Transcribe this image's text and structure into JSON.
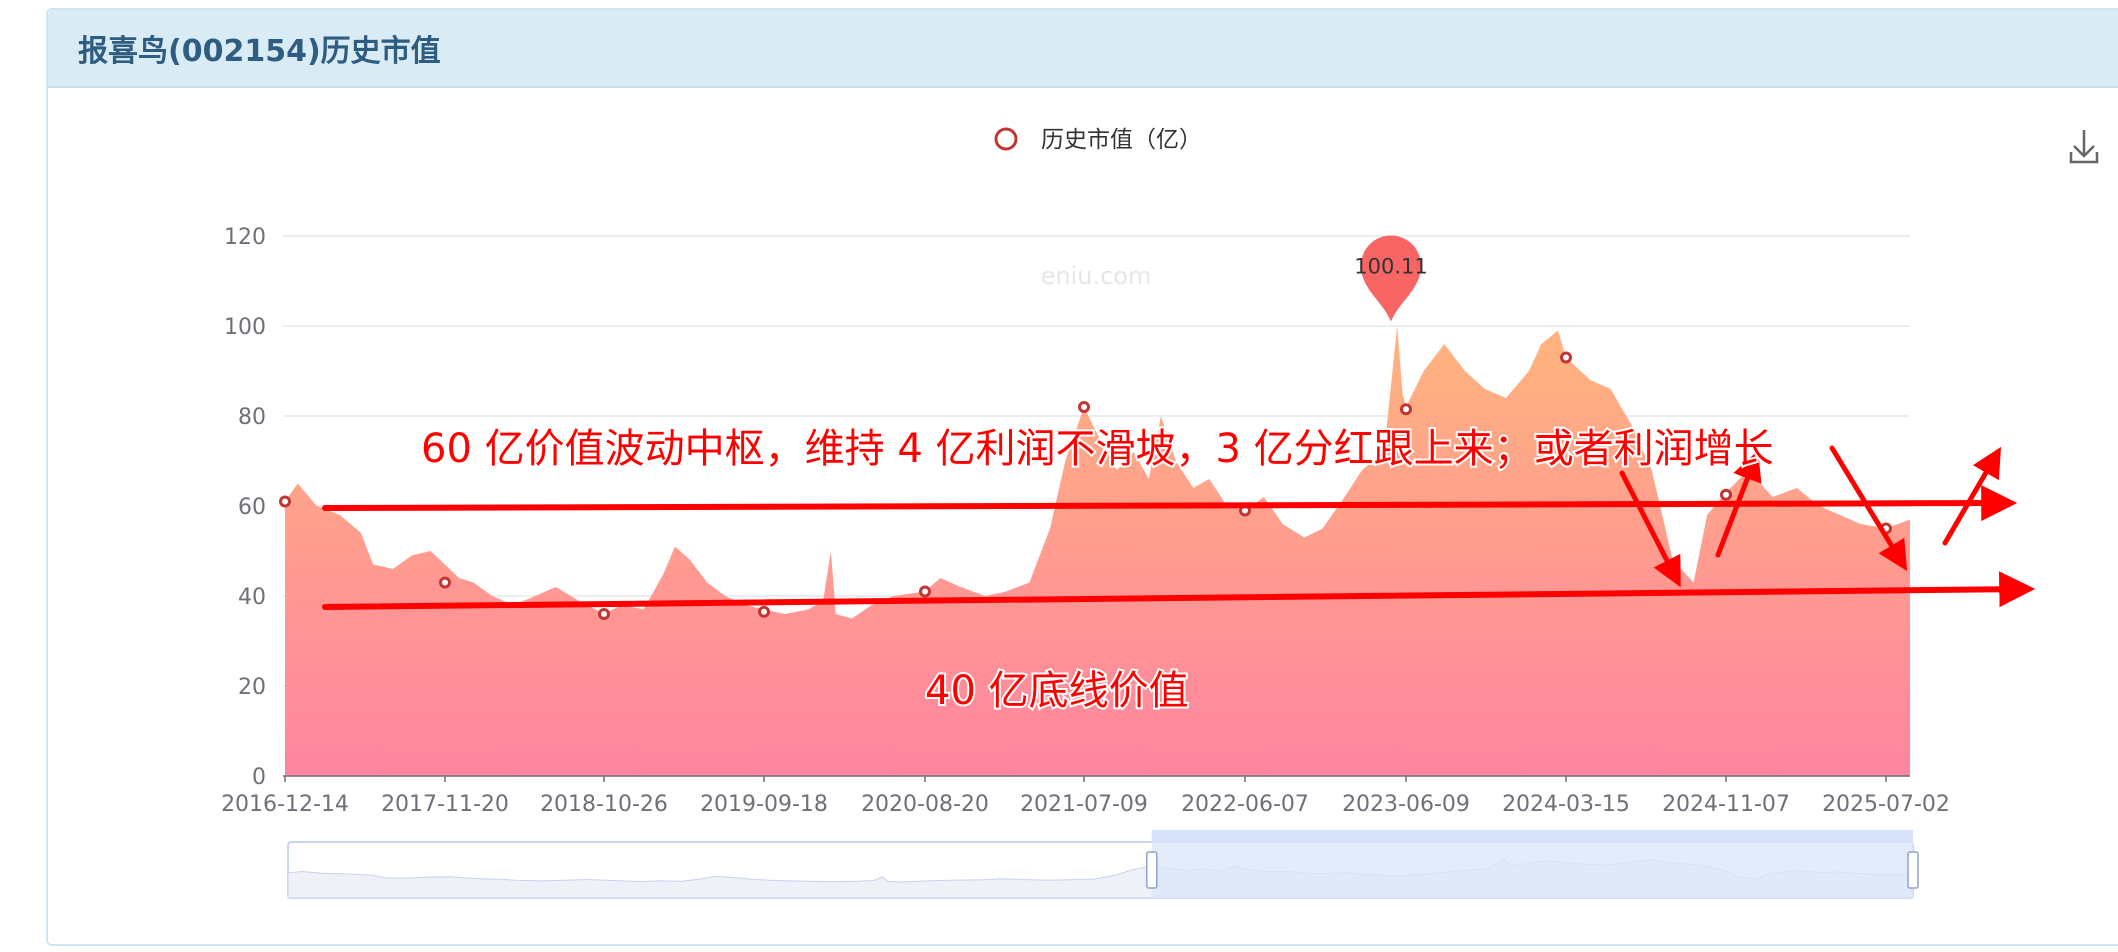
{
  "panel": {
    "title": "报喜鸟(002154)历史市值"
  },
  "watermark": "eniu.com",
  "colors": {
    "area_top": "#ffb47e",
    "area_bottom": "#ff84a0",
    "marker": "#c23531",
    "pin": "#f86565",
    "annotation": "#ff0000",
    "grid": "#e4e7ee",
    "slider_fill": "#dbe5fb",
    "slider_border": "#b7c7ec"
  },
  "icons": {
    "download": "download-icon"
  },
  "chart_data": {
    "type": "area",
    "title": "",
    "legend": {
      "label": "历史市值（亿）",
      "placement": "top-center"
    },
    "ylim": [
      0,
      120
    ],
    "yticks": [
      0,
      20,
      40,
      60,
      80,
      100,
      120
    ],
    "xlim": [
      "2016-12-14",
      "2025-07-18"
    ],
    "xticks": [
      "2016-12-14",
      "2017-11-20",
      "2018-10-26",
      "2019-09-18",
      "2020-08-20",
      "2021-07-09",
      "2022-06-07",
      "2023-06-09",
      "2024-03-15",
      "2024-11-07",
      "2025-07-02"
    ],
    "grid": true,
    "series": [
      {
        "name": "历史市值（亿）",
        "points": [
          [
            "2016-12-14",
            61
          ],
          [
            "2017-01-10",
            65
          ],
          [
            "2017-02-20",
            60
          ],
          [
            "2017-04-10",
            58
          ],
          [
            "2017-05-25",
            54
          ],
          [
            "2017-06-20",
            47
          ],
          [
            "2017-08-01",
            46
          ],
          [
            "2017-09-10",
            49
          ],
          [
            "2017-10-20",
            50
          ],
          [
            "2017-11-20",
            47
          ],
          [
            "2017-12-20",
            44
          ],
          [
            "2018-01-20",
            43
          ],
          [
            "2018-03-01",
            40
          ],
          [
            "2018-04-15",
            38
          ],
          [
            "2018-06-01",
            40
          ],
          [
            "2018-07-15",
            42
          ],
          [
            "2018-09-01",
            39
          ],
          [
            "2018-10-26",
            36
          ],
          [
            "2018-12-01",
            38
          ],
          [
            "2019-01-15",
            37
          ],
          [
            "2019-02-25",
            45
          ],
          [
            "2019-03-20",
            51
          ],
          [
            "2019-04-20",
            48
          ],
          [
            "2019-05-25",
            43
          ],
          [
            "2019-07-01",
            40
          ],
          [
            "2019-08-10",
            38
          ],
          [
            "2019-09-18",
            37
          ],
          [
            "2019-11-01",
            36
          ],
          [
            "2019-12-20",
            37
          ],
          [
            "2020-01-20",
            39
          ],
          [
            "2020-02-05",
            50
          ],
          [
            "2020-02-15",
            36
          ],
          [
            "2020-03-20",
            35
          ],
          [
            "2020-05-01",
            38
          ],
          [
            "2020-06-15",
            40
          ],
          [
            "2020-08-20",
            41
          ],
          [
            "2020-09-20",
            44
          ],
          [
            "2020-11-01",
            42
          ],
          [
            "2020-12-20",
            40
          ],
          [
            "2021-02-01",
            41
          ],
          [
            "2021-03-20",
            43
          ],
          [
            "2021-05-01",
            55
          ],
          [
            "2021-06-01",
            70
          ],
          [
            "2021-07-09",
            82
          ],
          [
            "2021-08-10",
            75
          ],
          [
            "2021-09-15",
            68
          ],
          [
            "2021-10-20",
            72
          ],
          [
            "2021-11-20",
            66
          ],
          [
            "2021-12-15",
            80
          ],
          [
            "2022-01-15",
            70
          ],
          [
            "2022-02-20",
            64
          ],
          [
            "2022-03-25",
            66
          ],
          [
            "2022-05-01",
            60
          ],
          [
            "2022-06-07",
            59
          ],
          [
            "2022-07-20",
            62
          ],
          [
            "2022-09-01",
            56
          ],
          [
            "2022-10-20",
            53
          ],
          [
            "2022-12-01",
            55
          ],
          [
            "2023-01-20",
            62
          ],
          [
            "2023-03-01",
            68
          ],
          [
            "2023-04-20",
            72
          ],
          [
            "2023-05-20",
            100.11
          ],
          [
            "2023-06-01",
            85
          ],
          [
            "2023-06-09",
            82
          ],
          [
            "2023-07-10",
            90
          ],
          [
            "2023-08-15",
            96
          ],
          [
            "2023-09-20",
            90
          ],
          [
            "2023-10-25",
            86
          ],
          [
            "2023-12-01",
            84
          ],
          [
            "2024-01-10",
            90
          ],
          [
            "2024-02-01",
            96
          ],
          [
            "2024-03-01",
            99
          ],
          [
            "2024-03-15",
            93
          ],
          [
            "2024-04-20",
            88
          ],
          [
            "2024-05-20",
            86
          ],
          [
            "2024-06-20",
            78
          ],
          [
            "2024-07-20",
            68
          ],
          [
            "2024-08-20",
            48
          ],
          [
            "2024-09-20",
            43
          ],
          [
            "2024-10-10",
            58
          ],
          [
            "2024-11-07",
            63
          ],
          [
            "2024-12-10",
            68
          ],
          [
            "2025-01-15",
            62
          ],
          [
            "2025-02-20",
            64
          ],
          [
            "2025-03-25",
            60
          ],
          [
            "2025-04-25",
            58
          ],
          [
            "2025-05-25",
            56
          ],
          [
            "2025-07-02",
            55
          ],
          [
            "2025-07-18",
            57
          ]
        ],
        "markers": [
          [
            "2016-12-14",
            61
          ],
          [
            "2017-11-20",
            43
          ],
          [
            "2018-10-26",
            36
          ],
          [
            "2019-09-18",
            36.5
          ],
          [
            "2020-08-20",
            41
          ],
          [
            "2021-07-09",
            82
          ],
          [
            "2022-06-07",
            59
          ],
          [
            "2023-06-09",
            81.5
          ],
          [
            "2024-03-15",
            93
          ],
          [
            "2024-11-07",
            62.5
          ],
          [
            "2025-07-02",
            55
          ]
        ]
      }
    ],
    "max_point": {
      "x": "2023-05-20",
      "y": 100.11,
      "label": "100.11"
    },
    "annotations": [
      {
        "text": "60 亿价值波动中枢，维持 4 亿利润不滑坡，3 亿分红跟上来；或者利润增长"
      },
      {
        "text": "40 亿底线价值"
      }
    ],
    "zoom_window": {
      "start": "2021-07-09",
      "end": "2025-07-18"
    }
  }
}
